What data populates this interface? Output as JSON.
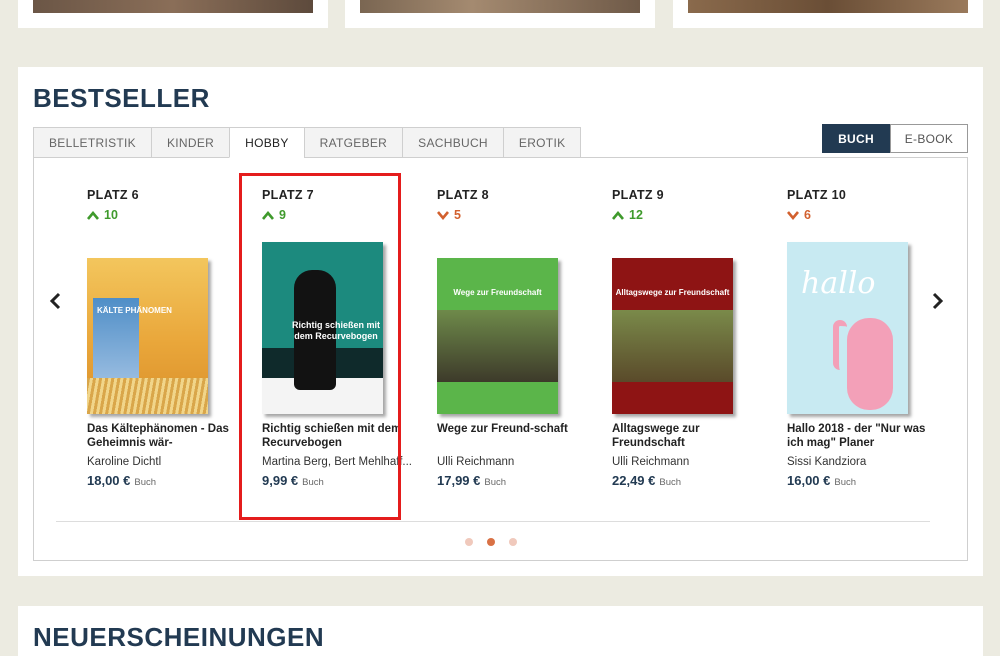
{
  "bestseller": {
    "title": "BESTSELLER",
    "tabs": [
      {
        "label": "BELLETRISTIK",
        "active": false
      },
      {
        "label": "KINDER",
        "active": false
      },
      {
        "label": "HOBBY",
        "active": true
      },
      {
        "label": "RATGEBER",
        "active": false
      },
      {
        "label": "SACHBUCH",
        "active": false
      },
      {
        "label": "EROTIK",
        "active": false
      }
    ],
    "format_toggle": {
      "buch": "BUCH",
      "ebook": "E-BOOK",
      "selected": "BUCH"
    },
    "items": [
      {
        "rank": "PLATZ 6",
        "direction": "up",
        "change": "10",
        "title": "Das Kältephänomen - Das Geheimnis wär-",
        "author": "Karoline Dichtl",
        "price": "18,00 €",
        "format": "Buch",
        "cover_text": "KÄLTE PHÄNOMEN"
      },
      {
        "rank": "PLATZ 7",
        "direction": "up",
        "change": "9",
        "title": "Richtig schießen mit dem Recurvebogen",
        "author": "Martina Berg, Bert Mehlhaff...",
        "price": "9,99 €",
        "format": "Buch",
        "cover_text": "Richtig schießen mit dem Recurvebogen"
      },
      {
        "rank": "PLATZ 8",
        "direction": "down",
        "change": "5",
        "title": "Wege zur Freund-schaft",
        "author": "Ulli Reichmann",
        "price": "17,99 €",
        "format": "Buch",
        "cover_text": "Wege zur Freundschaft"
      },
      {
        "rank": "PLATZ 9",
        "direction": "up",
        "change": "12",
        "title": "Alltagswege zur Freundschaft",
        "author": "Ulli Reichmann",
        "price": "22,49 €",
        "format": "Buch",
        "cover_text": "Alltagswege zur Freundschaft"
      },
      {
        "rank": "PLATZ 10",
        "direction": "down",
        "change": "6",
        "title": "Hallo 2018 - der \"Nur was ich mag\" Planer",
        "author": "Sissi Kandziora",
        "price": "16,00 €",
        "format": "Buch",
        "cover_text": "hallo"
      }
    ],
    "pagination": {
      "pages": 3,
      "active_index": 1
    }
  },
  "neuerscheinungen": {
    "title": "NEUERSCHEINUNGEN"
  },
  "colors": {
    "accent": "#223a52",
    "up": "#3f9a2c",
    "down": "#d2602e",
    "highlight": "#e41c1c"
  }
}
